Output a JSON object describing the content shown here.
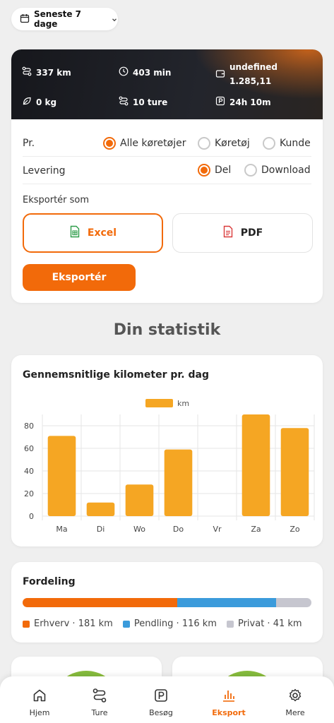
{
  "date_range": {
    "label": "Seneste 7 dage"
  },
  "stats": {
    "distance": "337 km",
    "duration": "403 min",
    "amount_line1": "undefined",
    "amount_line2": "1.285,11",
    "co2": "0 kg",
    "trips": "10 ture",
    "parking": "24h 10m"
  },
  "export": {
    "per_label": "Pr.",
    "per_options": [
      "Alle køretøjer",
      "Køretøj",
      "Kunde"
    ],
    "per_selected": "Alle køretøjer",
    "delivery_label": "Levering",
    "delivery_options": [
      "Del",
      "Download"
    ],
    "delivery_selected": "Del",
    "format_label": "Eksportér som",
    "formats": [
      "Excel",
      "PDF"
    ],
    "format_selected": "Excel",
    "export_button": "Eksportér"
  },
  "section_title": "Din statistik",
  "avg_chart_title": "Gennemsnitlige kilometer pr. dag",
  "chart_data": {
    "type": "bar",
    "categories": [
      "Ma",
      "Di",
      "Wo",
      "Do",
      "Vr",
      "Za",
      "Zo"
    ],
    "series": [
      {
        "name": "km",
        "values": [
          71,
          12,
          28,
          59,
          0,
          90,
          78
        ],
        "color": "#f5a623"
      }
    ],
    "ylim": [
      0,
      90
    ],
    "yticks": [
      0,
      20,
      40,
      60,
      80
    ],
    "grid": true,
    "legend": "top-center"
  },
  "distribution": {
    "title": "Fordeling",
    "segments": [
      {
        "label": "Erhverv · 181 km",
        "value": 181,
        "color": "#f26a0a"
      },
      {
        "label": "Pendling · 116 km",
        "value": 116,
        "color": "#3b9bdb"
      },
      {
        "label": "Privat · 41 km",
        "value": 41,
        "color": "#c6c6cf"
      }
    ]
  },
  "nav": {
    "items": [
      "Hjem",
      "Ture",
      "Besøg",
      "Eksport",
      "Mere"
    ],
    "active": "Eksport"
  },
  "colors": {
    "accent": "#f26a0a",
    "bar": "#f5a623",
    "excel": "#2e9d4a",
    "pdf": "#d93a3a"
  }
}
